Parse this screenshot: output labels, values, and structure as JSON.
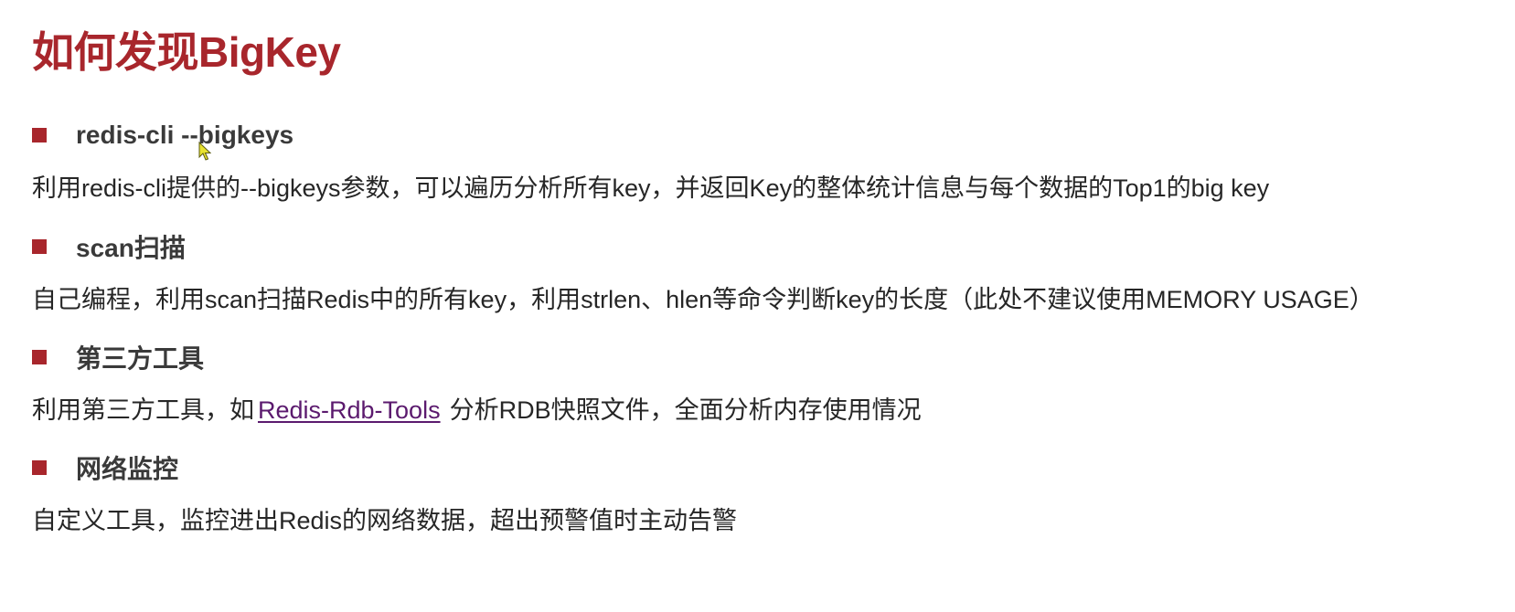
{
  "title": "如何发现BigKey",
  "sections": [
    {
      "heading": "redis-cli --bigkeys",
      "description": "利用redis-cli提供的--bigkeys参数，可以遍历分析所有key，并返回Key的整体统计信息与每个数据的Top1的big key"
    },
    {
      "heading": "scan扫描",
      "description": "自己编程，利用scan扫描Redis中的所有key，利用strlen、hlen等命令判断key的长度（此处不建议使用MEMORY USAGE）"
    },
    {
      "heading": "第三方工具",
      "description_before": "利用第三方工具，如",
      "link": "Redis-Rdb-Tools",
      "description_after": "分析RDB快照文件，全面分析内存使用情况"
    },
    {
      "heading": "网络监控",
      "description": "自定义工具，监控进出Redis的网络数据，超出预警值时主动告警"
    }
  ],
  "colors": {
    "accent": "#a8262c",
    "text": "#262626",
    "link": "#5b1a6e"
  },
  "icons": {
    "bullet": "square-bullet-icon",
    "cursor": "mouse-pointer-icon"
  }
}
